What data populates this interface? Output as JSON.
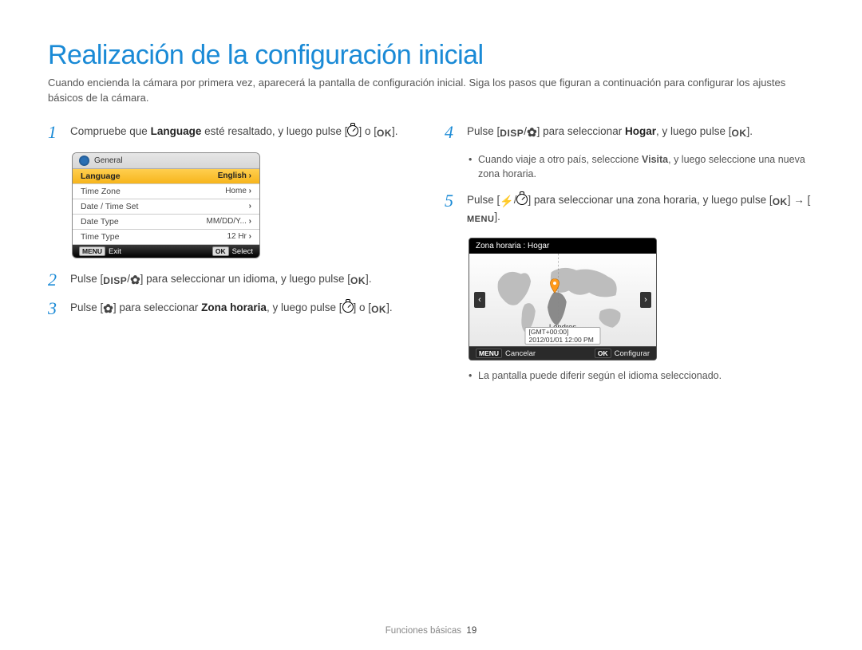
{
  "title": "Realización de la configuración inicial",
  "intro": "Cuando encienda la cámara por primera vez, aparecerá la pantalla de configuración inicial. Siga los pasos que figuran a continuación para configurar los ajustes básicos de la cámara.",
  "steps": {
    "s1": {
      "num": "1",
      "pre": "Compruebe que ",
      "bold": "Language",
      "post": " esté resaltado, y luego pulse "
    },
    "s2": {
      "num": "2",
      "full_a": "Pulse [",
      "full_b": "] para seleccionar un idioma, y luego pulse ["
    },
    "s3": {
      "num": "3",
      "pre": "Pulse [",
      "mid": "] para seleccionar ",
      "bold": "Zona horaria",
      "post": ", y luego pulse "
    },
    "s4": {
      "num": "4",
      "pre": "Pulse [",
      "mid": "] para seleccionar ",
      "bold": "Hogar",
      "post": ", y luego pulse ["
    },
    "s4_note_a": "Cuando viaje a otro país, seleccione ",
    "s4_note_bold": "Visita",
    "s4_note_b": ", y luego seleccione una nueva zona horaria.",
    "s5": {
      "num": "5",
      "pre": "Pulse [",
      "mid": "] para seleccionar una zona horaria, y luego pulse ["
    },
    "s5_note": "La pantalla puede diferir según el idioma seleccionado."
  },
  "icons": {
    "disp": "DISP",
    "ok": "OK",
    "menu": "MENU",
    "or": " o ",
    "slash": "/",
    "dot": ".",
    "bracket_open": "[",
    "bracket_close": "]",
    "arrow": "→"
  },
  "lcd_general": {
    "header": "General",
    "rows": [
      {
        "label": "Language",
        "value": "English",
        "selected": true
      },
      {
        "label": "Time Zone",
        "value": "Home",
        "selected": false
      },
      {
        "label": "Date / Time Set",
        "value": "",
        "selected": false
      },
      {
        "label": "Date Type",
        "value": "MM/DD/Y...",
        "selected": false
      },
      {
        "label": "Time Type",
        "value": "12 Hr",
        "selected": false
      }
    ],
    "footer_left_badge": "MENU",
    "footer_left": "Exit",
    "footer_right_badge": "OK",
    "footer_right": "Select"
  },
  "lcd_map": {
    "header": "Zona horaria : Hogar",
    "city": "Londres",
    "gmt": "[GMT+00:00] 2012/01/01 12:00 PM",
    "footer_left_badge": "MENU",
    "footer_left": "Cancelar",
    "footer_right_badge": "OK",
    "footer_right": "Configurar"
  },
  "footer": {
    "section": "Funciones básicas",
    "page": "19"
  }
}
